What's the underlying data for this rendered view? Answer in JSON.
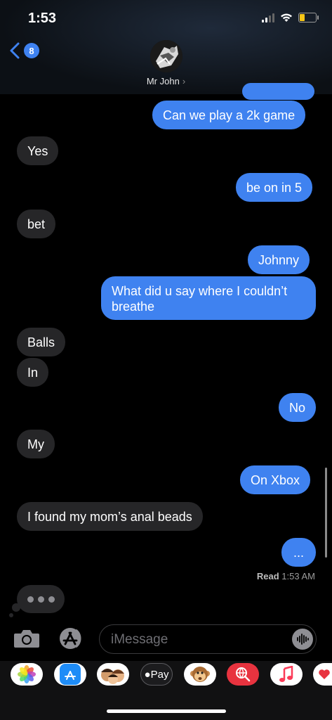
{
  "status": {
    "time": "1:53"
  },
  "header": {
    "back_count": "8",
    "contact_name": "Mr John"
  },
  "messages": [
    {
      "text": "Can we play a 2k game",
      "from": "me"
    },
    {
      "text": "Yes",
      "from": "them"
    },
    {
      "text": "be on in 5",
      "from": "me"
    },
    {
      "text": "bet",
      "from": "them"
    },
    {
      "text": "Johnny",
      "from": "me"
    },
    {
      "text": "What did u say where I couldn’t\nbreathe",
      "from": "me"
    },
    {
      "text": "Balls",
      "from": "them"
    },
    {
      "text": "In",
      "from": "them"
    },
    {
      "text": "No",
      "from": "me"
    },
    {
      "text": "My",
      "from": "them"
    },
    {
      "text": "On Xbox",
      "from": "me"
    },
    {
      "text": "I found my mom’s anal beads",
      "from": "them"
    },
    {
      "text": "...",
      "from": "me"
    }
  ],
  "read_receipt": {
    "label": "Read",
    "time": "1:53 AM"
  },
  "composer": {
    "placeholder": "iMessage"
  },
  "app_drawer": {
    "apple_pay_label": "Pay",
    "apps": [
      "photos-icon",
      "app-store-icon",
      "memoji-icon",
      "apple-pay-icon",
      "animoji-icon",
      "web-search-icon",
      "music-icon",
      "digital-touch-icon"
    ]
  },
  "colors": {
    "sent_bubble": "#3f82f0",
    "received_bubble": "#262628",
    "background": "#000000",
    "battery": "#f5c517"
  }
}
